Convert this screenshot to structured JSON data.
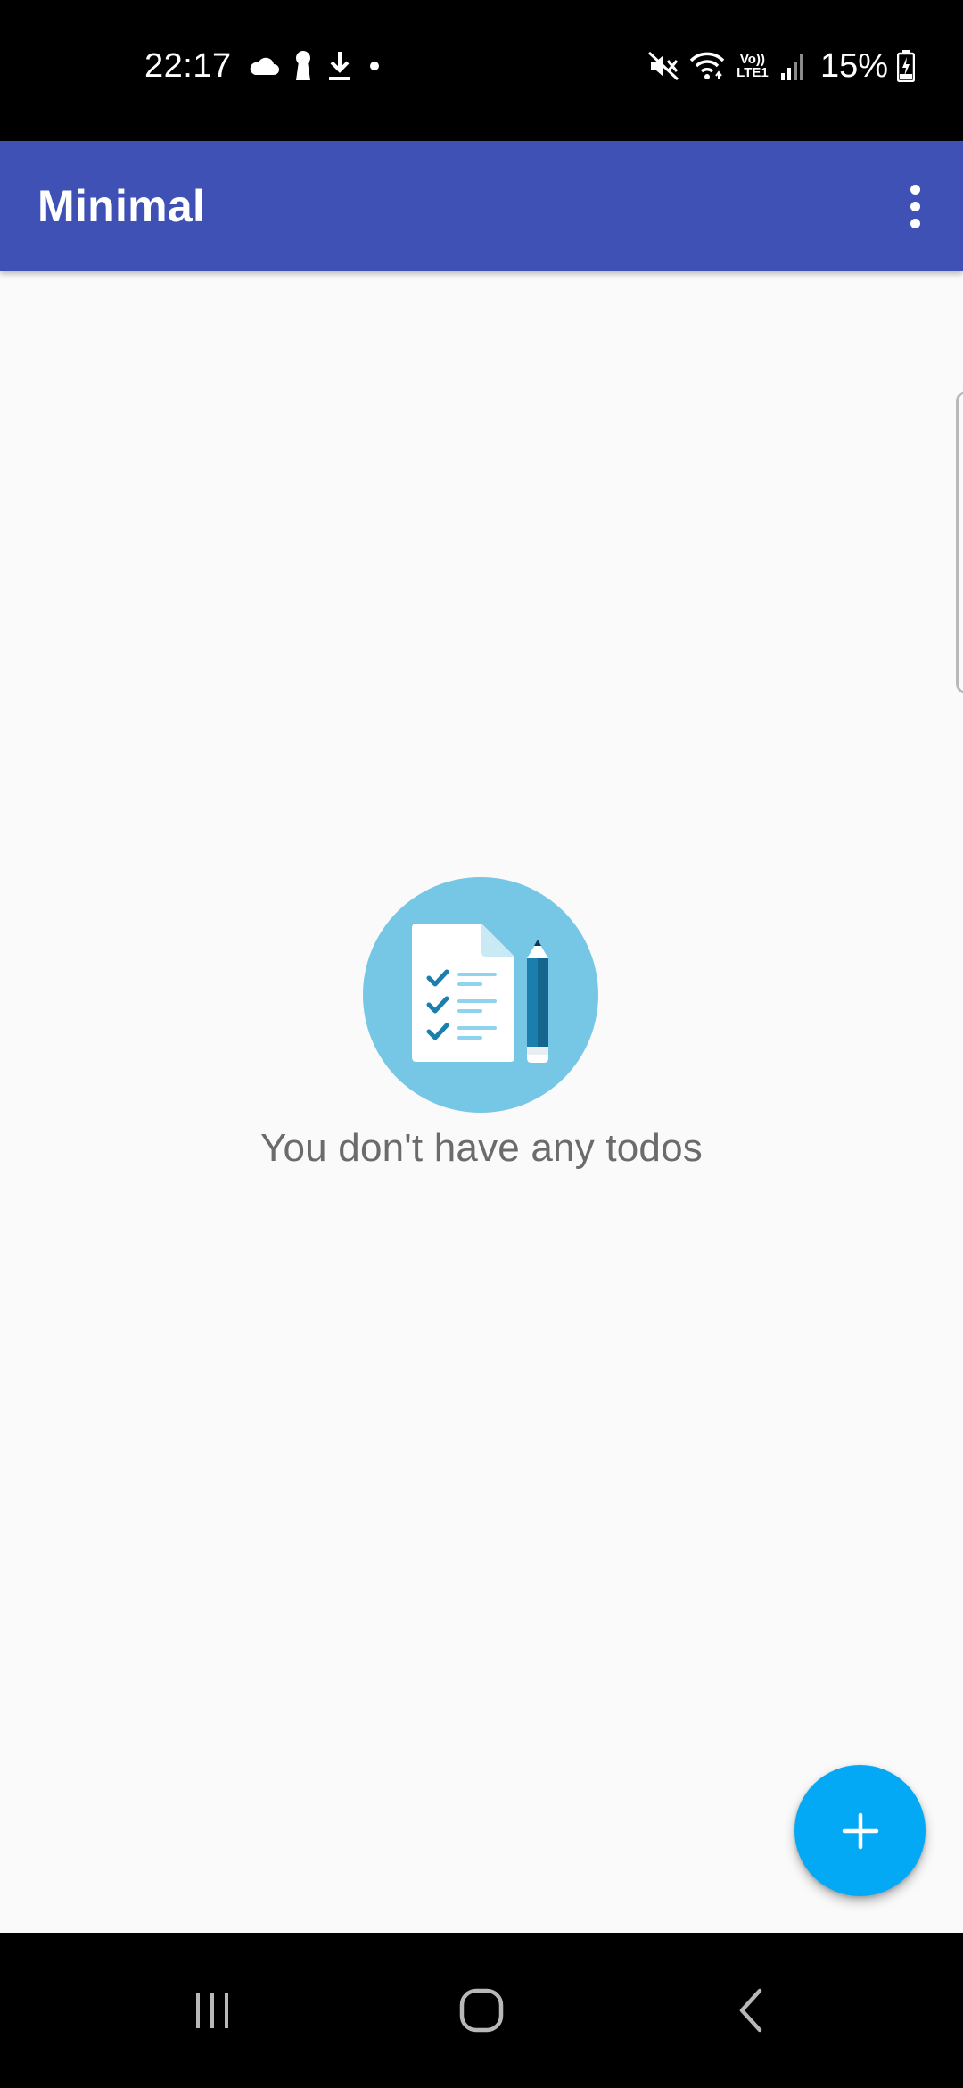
{
  "status_bar": {
    "time": "22:17",
    "battery_percent": "15%",
    "left_icons": [
      "cloud-icon",
      "keyhole-icon",
      "download-icon",
      "notification-dot-icon"
    ],
    "right_icons": [
      "mute-icon",
      "wifi-icon",
      "volte-lte-icon",
      "signal-icon",
      "battery-charging-icon"
    ],
    "volte_line1": "Vo))",
    "volte_line2": "LTE1"
  },
  "app_bar": {
    "title": "Minimal",
    "color": "#3f51b5",
    "overflow_icon": "more-vert-icon"
  },
  "empty_state": {
    "icon": "todo-checklist-pencil-icon",
    "circle_color": "#76c7e6",
    "message": "You don't have any todos"
  },
  "fab": {
    "icon": "plus-icon",
    "color": "#03a9f4"
  },
  "nav_bar": {
    "buttons": [
      "recents-icon",
      "home-icon",
      "back-icon"
    ]
  }
}
